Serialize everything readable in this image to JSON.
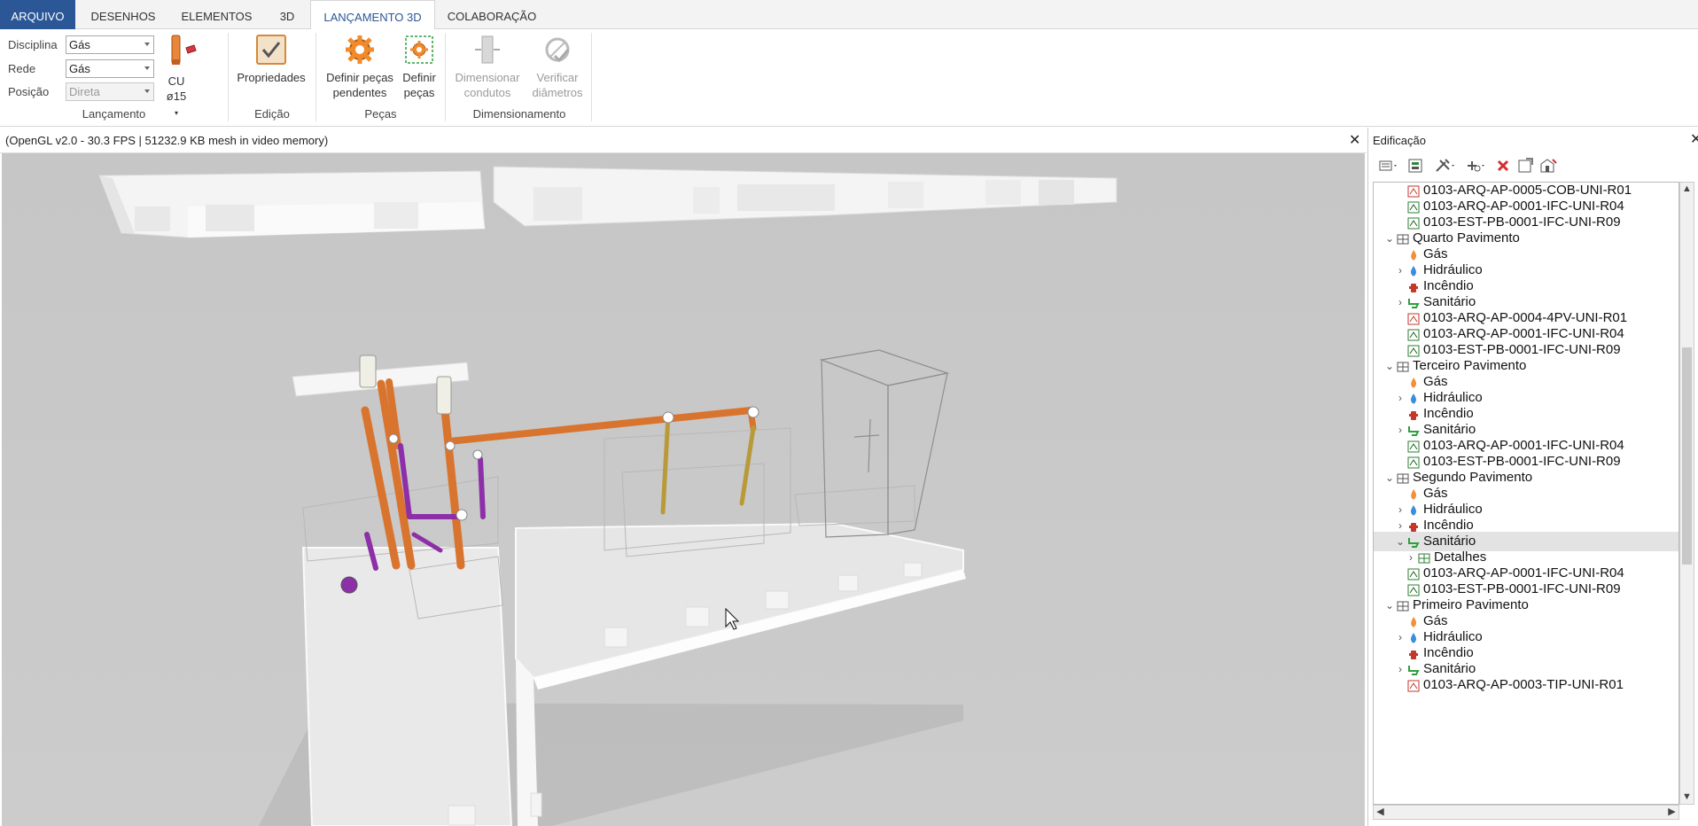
{
  "menu": {
    "tabs": [
      {
        "label": "ARQUIVO"
      },
      {
        "label": "DESENHOS"
      },
      {
        "label": "ELEMENTOS"
      },
      {
        "label": "3D"
      },
      {
        "label": "LANÇAMENTO 3D"
      },
      {
        "label": "COLABORAÇÃO"
      }
    ],
    "active_tab": "LANÇAMENTO 3D"
  },
  "ribbon": {
    "lancamento": {
      "disciplina_label": "Disciplina",
      "disciplina_value": "Gás",
      "rede_label": "Rede",
      "rede_value": "Gás",
      "posicao_label": "Posição",
      "posicao_value": "Direta",
      "material_line1": "CU",
      "material_line2": "ø15",
      "group_label": "Lançamento"
    },
    "edicao": {
      "propriedades": "Propriedades",
      "group_label": "Edição"
    },
    "pecas": {
      "definir_pendentes_l1": "Definir peças",
      "definir_pendentes_l2": "pendentes",
      "definir_l1": "Definir",
      "definir_l2": "peças",
      "group_label": "Peças"
    },
    "dimensionamento": {
      "dimensionar_l1": "Dimensionar",
      "dimensionar_l2": "condutos",
      "verificar_l1": "Verificar",
      "verificar_l2": "diâmetros",
      "group_label": "Dimensionamento"
    }
  },
  "viewport": {
    "status": "(OpenGL v2.0 - 30.3 FPS | 51232.9 KB mesh in video memory)",
    "close_glyph": "✕"
  },
  "panel": {
    "title": "Edificação",
    "close_glyph": "✕",
    "tree": [
      {
        "label": "0103-ARQ-AP-0005-COB-UNI-R01",
        "icon": "pdf-file-icon",
        "level": 2,
        "expander": ""
      },
      {
        "label": "0103-ARQ-AP-0001-IFC-UNI-R04",
        "icon": "ifc-file-icon",
        "level": 2,
        "expander": ""
      },
      {
        "label": "0103-EST-PB-0001-IFC-UNI-R09",
        "icon": "ifc-file-icon",
        "level": 2,
        "expander": ""
      },
      {
        "label": "Quarto Pavimento",
        "icon": "floor-icon",
        "level": 1,
        "expander": "⌄"
      },
      {
        "label": "Gás",
        "icon": "gas-flame-icon",
        "level": 2,
        "expander": ""
      },
      {
        "label": "Hidráulico",
        "icon": "water-drop-icon",
        "level": 2,
        "expander": "›"
      },
      {
        "label": "Incêndio",
        "icon": "fire-hydrant-icon",
        "level": 2,
        "expander": ""
      },
      {
        "label": "Sanitário",
        "icon": "toilet-icon",
        "level": 2,
        "expander": "›"
      },
      {
        "label": "0103-ARQ-AP-0004-4PV-UNI-R01",
        "icon": "pdf-file-icon",
        "level": 2,
        "expander": ""
      },
      {
        "label": "0103-ARQ-AP-0001-IFC-UNI-R04",
        "icon": "ifc-file-icon",
        "level": 2,
        "expander": ""
      },
      {
        "label": "0103-EST-PB-0001-IFC-UNI-R09",
        "icon": "ifc-file-icon",
        "level": 2,
        "expander": ""
      },
      {
        "label": "Terceiro Pavimento",
        "icon": "floor-icon",
        "level": 1,
        "expander": "⌄"
      },
      {
        "label": "Gás",
        "icon": "gas-flame-icon",
        "level": 2,
        "expander": ""
      },
      {
        "label": "Hidráulico",
        "icon": "water-drop-icon",
        "level": 2,
        "expander": "›"
      },
      {
        "label": "Incêndio",
        "icon": "fire-hydrant-icon",
        "level": 2,
        "expander": ""
      },
      {
        "label": "Sanitário",
        "icon": "toilet-icon",
        "level": 2,
        "expander": "›"
      },
      {
        "label": "0103-ARQ-AP-0001-IFC-UNI-R04",
        "icon": "ifc-file-icon",
        "level": 2,
        "expander": ""
      },
      {
        "label": "0103-EST-PB-0001-IFC-UNI-R09",
        "icon": "ifc-file-icon",
        "level": 2,
        "expander": ""
      },
      {
        "label": "Segundo Pavimento",
        "icon": "floor-icon",
        "level": 1,
        "expander": "⌄"
      },
      {
        "label": "Gás",
        "icon": "gas-flame-icon",
        "level": 2,
        "expander": ""
      },
      {
        "label": "Hidráulico",
        "icon": "water-drop-icon",
        "level": 2,
        "expander": "›"
      },
      {
        "label": "Incêndio",
        "icon": "fire-hydrant-icon",
        "level": 2,
        "expander": "›"
      },
      {
        "label": "Sanitário",
        "icon": "toilet-icon",
        "level": 2,
        "expander": "⌄",
        "selected": true
      },
      {
        "label": "Detalhes",
        "icon": "details-icon",
        "level": 3,
        "expander": "›"
      },
      {
        "label": "0103-ARQ-AP-0001-IFC-UNI-R04",
        "icon": "ifc-file-icon",
        "level": 2,
        "expander": ""
      },
      {
        "label": "0103-EST-PB-0001-IFC-UNI-R09",
        "icon": "ifc-file-icon",
        "level": 2,
        "expander": ""
      },
      {
        "label": "Primeiro Pavimento",
        "icon": "floor-icon",
        "level": 1,
        "expander": "⌄"
      },
      {
        "label": "Gás",
        "icon": "gas-flame-icon",
        "level": 2,
        "expander": ""
      },
      {
        "label": "Hidráulico",
        "icon": "water-drop-icon",
        "level": 2,
        "expander": "›"
      },
      {
        "label": "Incêndio",
        "icon": "fire-hydrant-icon",
        "level": 2,
        "expander": ""
      },
      {
        "label": "Sanitário",
        "icon": "toilet-icon",
        "level": 2,
        "expander": "›"
      },
      {
        "label": "0103-ARQ-AP-0003-TIP-UNI-R01",
        "icon": "pdf-file-icon",
        "level": 2,
        "expander": ""
      }
    ],
    "colors": {
      "accent": "#2b5797",
      "gas": "#f0913a",
      "water": "#3a8de0",
      "fire": "#c0392b",
      "sanitary": "#2e9e3e",
      "pipe_orange": "#d9742f",
      "pipe_purple": "#8d2fa8",
      "pipe_yellow": "#b99a3a"
    }
  }
}
